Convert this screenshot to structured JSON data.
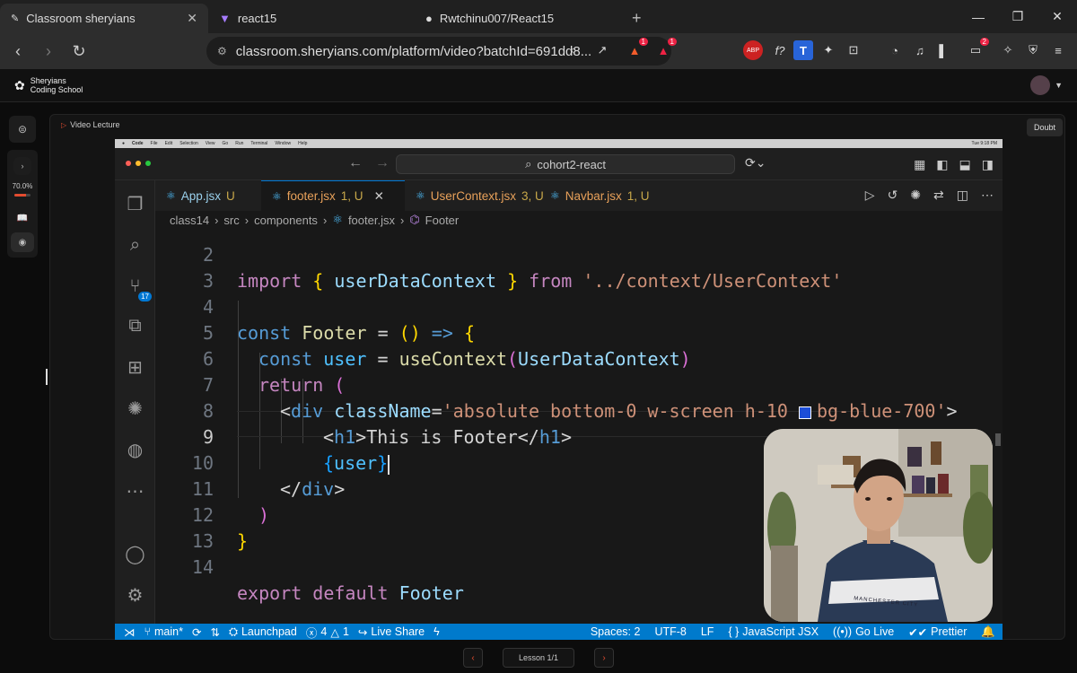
{
  "browser": {
    "tabs": [
      {
        "title": "Classroom sheryians",
        "icon": "sheryians-icon"
      },
      {
        "title": "react15",
        "icon": "vite-icon"
      },
      {
        "title": "Rwtchinu007/React15",
        "icon": "github-icon"
      }
    ],
    "url": "classroom.sheryians.com/platform/video?batchId=691dd8...",
    "brave_badge": "1",
    "alert_badge": "1",
    "wallet_badge": "2",
    "ext_labels": {
      "abp": "ABP",
      "fx": "f?",
      "t": "T"
    }
  },
  "site": {
    "logo_line1": "Sheryians",
    "logo_line2": "Coding School",
    "progress_text": "70.0%",
    "progress_fraction": 0.7,
    "video_header": "Video Lecture",
    "doubt_label": "Doubt",
    "lesson_label": "Lesson 1/1"
  },
  "vscode": {
    "mac_menu": [
      "Code",
      "File",
      "Edit",
      "Selection",
      "View",
      "Go",
      "Run",
      "Terminal",
      "Window",
      "Help"
    ],
    "mac_clock": "Tue 9:18 PM",
    "command_center": "cohort2-react",
    "source_control_badge": "17",
    "tabs": [
      {
        "name": "App.jsx",
        "status": "U"
      },
      {
        "name": "footer.jsx",
        "status": "1, U"
      },
      {
        "name": "UserContext.jsx",
        "status": "3, U"
      },
      {
        "name": "Navbar.jsx",
        "status": "1, U"
      }
    ],
    "breadcrumb": [
      "class14",
      "src",
      "components",
      "footer.jsx",
      "Footer"
    ],
    "line_numbers": [
      "2",
      "3",
      "4",
      "5",
      "6",
      "7",
      "8",
      "9",
      "10",
      "11",
      "12",
      "13",
      "14"
    ],
    "code": {
      "l2_import": "import",
      "l2_open": "{",
      "l2_name": "userDataContext",
      "l2_close": "}",
      "l2_from": "from",
      "l2_path": "'../context/UserContext'",
      "l4_const": "const",
      "l4_name": "Footer",
      "l4_eq": "=",
      "l4_parens": "()",
      "l4_arrow": "=>",
      "l4_brace": "{",
      "l5_const": "const",
      "l5_var": "user",
      "l5_eq": "=",
      "l5_fn": "useContext",
      "l5_open": "(",
      "l5_arg": "UserDataContext",
      "l5_close": ")",
      "l6_return": "return",
      "l6_paren": "(",
      "l7_open": "<",
      "l7_tag": "div",
      "l7_attr": "className",
      "l7_eq": "=",
      "l7_str1": "'absolute bottom-0 w-screen h-10 ",
      "l7_str2": "bg-blue-700'",
      "l7_close": ">",
      "l8_open": "<",
      "l8_tag": "h1",
      "l8_gt": ">",
      "l8_text": "This is Footer",
      "l8_close_open": "</",
      "l8_close_tag": "h1",
      "l8_close_gt": ">",
      "l9_open": "{",
      "l9_var": "user",
      "l9_close": "}",
      "l10_open": "</",
      "l10_tag": "div",
      "l10_gt": ">",
      "l11_paren": ")",
      "l12_brace": "}",
      "l14_export": "export",
      "l14_default": "default",
      "l14_name": "Footer"
    },
    "status": {
      "branch": "main*",
      "launchpad": "Launchpad",
      "errors": "4",
      "warnings": "1",
      "live_share": "Live Share",
      "spaces": "Spaces: 2",
      "encoding": "UTF-8",
      "eol": "LF",
      "language": "JavaScript JSX",
      "go_live": "Go Live",
      "prettier": "Prettier"
    },
    "swatch_color": "#1d4ed8"
  },
  "webcam": {
    "shirt_text": "MANCHESTER CITY"
  },
  "colors": {
    "accent": "#e34c30",
    "vscode_blue": "#007acc"
  }
}
